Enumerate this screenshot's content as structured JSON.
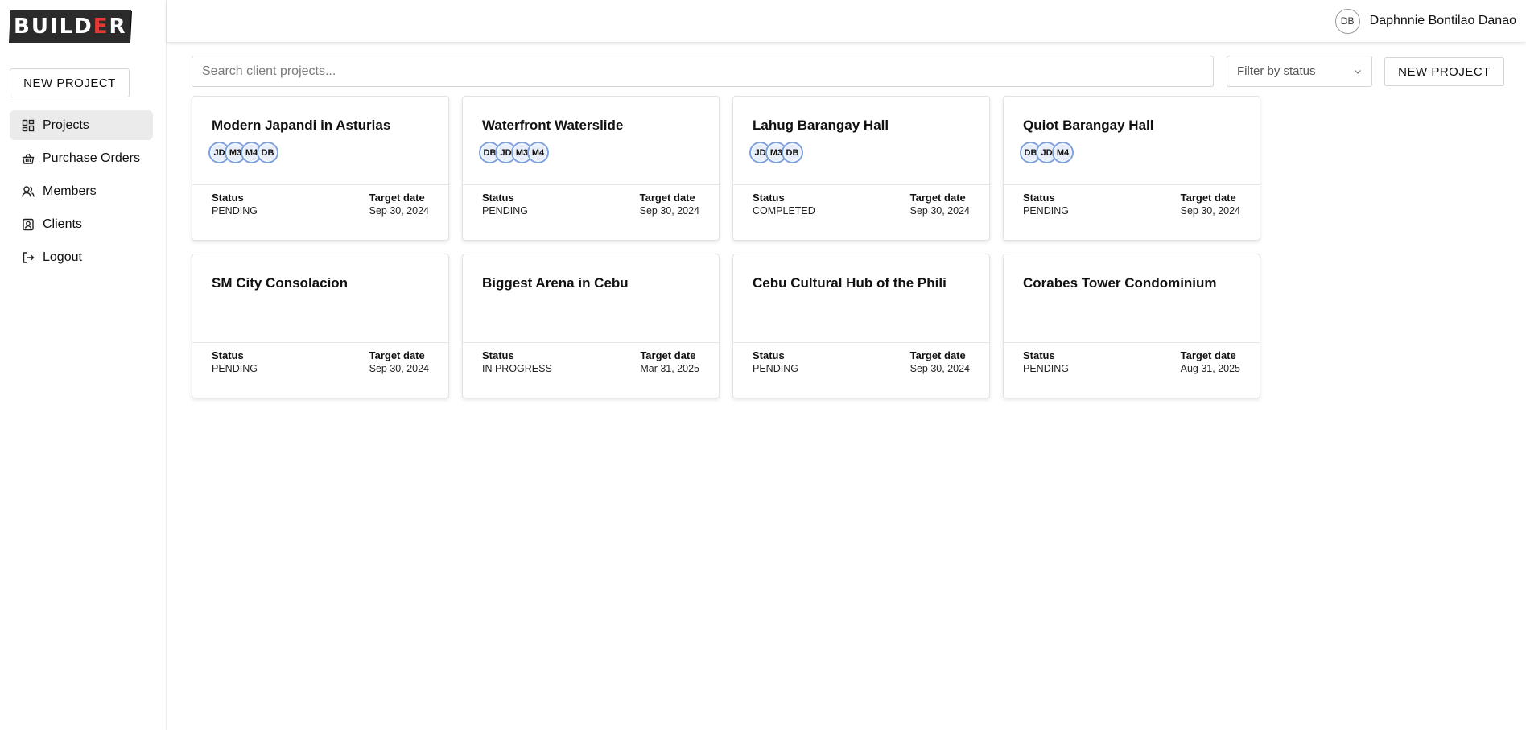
{
  "brand": {
    "logo_text_a": "BUILD",
    "logo_text_b": "E",
    "logo_text_c": "R"
  },
  "sidebar": {
    "new_project_label": "NEW PROJECT",
    "items": [
      {
        "label": "Projects",
        "icon": "grid-icon",
        "active": true
      },
      {
        "label": "Purchase Orders",
        "icon": "basket-icon",
        "active": false
      },
      {
        "label": "Members",
        "icon": "users-icon",
        "active": false
      },
      {
        "label": "Clients",
        "icon": "contact-icon",
        "active": false
      },
      {
        "label": "Logout",
        "icon": "logout-icon",
        "active": false
      }
    ]
  },
  "header": {
    "user_initials": "DB",
    "user_name": "Daphnnie Bontilao Danao"
  },
  "toolbar": {
    "search_placeholder": "Search client projects...",
    "filter_label": "Filter by status",
    "new_project_label": "NEW PROJECT"
  },
  "labels": {
    "status": "Status",
    "target_date": "Target date"
  },
  "projects": [
    {
      "title": "Modern Japandi in Asturias",
      "members": [
        "JD",
        "M3",
        "M4",
        "DB"
      ],
      "status": "PENDING",
      "target_date": "Sep 30, 2024"
    },
    {
      "title": "Waterfront Waterslide",
      "members": [
        "DB",
        "JD",
        "M3",
        "M4"
      ],
      "status": "PENDING",
      "target_date": "Sep 30, 2024"
    },
    {
      "title": "Lahug Barangay Hall",
      "members": [
        "JD",
        "M3",
        "DB"
      ],
      "status": "COMPLETED",
      "target_date": "Sep 30, 2024"
    },
    {
      "title": "Quiot Barangay Hall",
      "members": [
        "DB",
        "JD",
        "M4"
      ],
      "status": "PENDING",
      "target_date": "Sep 30, 2024"
    },
    {
      "title": "SM City Consolacion",
      "members": [],
      "status": "PENDING",
      "target_date": "Sep 30, 2024"
    },
    {
      "title": "Biggest Arena in Cebu",
      "members": [],
      "status": "IN PROGRESS",
      "target_date": "Mar 31, 2025"
    },
    {
      "title": "Cebu Cultural Hub of the Phili",
      "members": [],
      "status": "PENDING",
      "target_date": "Sep 30, 2024"
    },
    {
      "title": "Corabes Tower Condominium",
      "members": [],
      "status": "PENDING",
      "target_date": "Aug 31, 2025"
    }
  ],
  "colors": {
    "accent_red": "#e53935",
    "member_ring": "#7ea2e0",
    "active_nav": "#ebebeb"
  }
}
